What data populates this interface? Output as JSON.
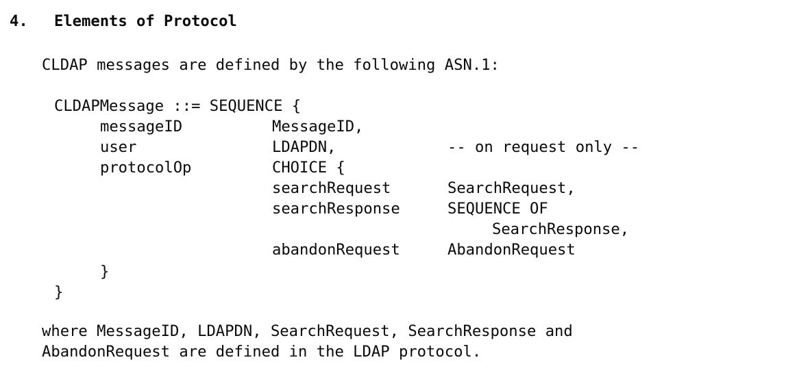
{
  "document": {
    "type": "rfc-text-page",
    "background_color": "#ffffff",
    "text_color": "#000000",
    "section": {
      "number": "4.",
      "title": "Elements of Protocol"
    },
    "intro_paragraph": "CLDAP messages are defined by the following ASN.1:",
    "asn1_block": {
      "header": "CLDAPMessage ::= SEQUENCE {",
      "fields": [
        {
          "name": "messageID",
          "type": "MessageID,",
          "comment": ""
        },
        {
          "name": "user",
          "type": "LDAPDN,",
          "comment": "-- on request only --"
        },
        {
          "name": "protocolOp",
          "type": "CHOICE {",
          "comment": ""
        }
      ],
      "choice_members": [
        {
          "name": "searchRequest",
          "type": "SearchRequest,"
        },
        {
          "name": "searchResponse",
          "type": "SEQUENCE OF"
        },
        {
          "name": "",
          "type": "SearchResponse,"
        },
        {
          "name": "abandonRequest",
          "type": "AbandonRequest"
        }
      ],
      "inner_close_brace": "}",
      "outer_close_brace": "}"
    },
    "closing_paragraph": {
      "line1": "where MessageID, LDAPDN, SearchRequest, SearchResponse and",
      "line2": "AbandonRequest are defined in the LDAP protocol."
    }
  }
}
